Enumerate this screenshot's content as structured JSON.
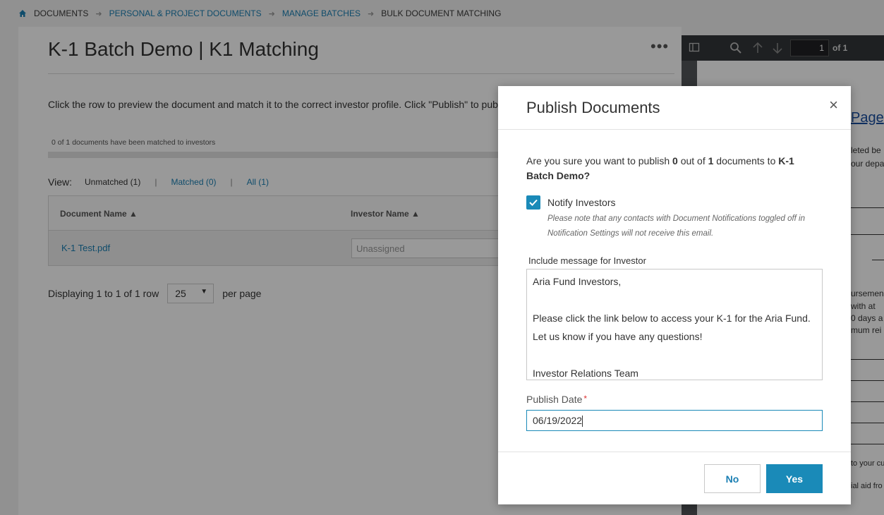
{
  "breadcrumb": {
    "items": [
      {
        "label": "DOCUMENTS"
      },
      {
        "label": "PERSONAL & PROJECT DOCUMENTS"
      },
      {
        "label": "MANAGE BATCHES"
      },
      {
        "label": "BULK DOCUMENT MATCHING"
      }
    ]
  },
  "page": {
    "title": "K-1 Batch Demo | K1 Matching",
    "more_label": "•••",
    "instructions": "Click the row to preview the document and match it to the correct investor profile. Click \"Publish\" to publish",
    "progress_text": "0 of 1 documents have been matched to investors",
    "view": {
      "label": "View:",
      "options": [
        {
          "label": "Unmatched (1)"
        },
        {
          "label": "Matched (0)"
        },
        {
          "label": "All (1)"
        }
      ]
    },
    "table": {
      "columns": [
        "Document Name ▲",
        "Investor Name ▲"
      ],
      "rows": [
        {
          "document": "K-1 Test.pdf",
          "investor_placeholder": "Unassigned"
        }
      ]
    },
    "paging": {
      "display_text": "Displaying 1 to 1 of 1 row",
      "page_size": "25",
      "per_page": "per page"
    }
  },
  "pdf": {
    "page_number": "1",
    "of_text": "of 1",
    "page_title_fragment": "Page",
    "snippets": [
      "leted be",
      "our depa",
      "ursemen",
      " with at",
      "0 days a",
      "mum rei",
      "to your cu",
      "ial aid fro"
    ]
  },
  "modal": {
    "title": "Publish Documents",
    "close_label": "×",
    "confirm": {
      "prefix": "Are you sure you want to publish ",
      "count": "0",
      "middle": " out of ",
      "total": "1",
      "suffix": " documents to ",
      "batch": "K-1 Batch Demo?"
    },
    "notify": {
      "label": "Notify Investors",
      "checked": true,
      "note": "Please note that any contacts with Document Notifications toggled off in Notification Settings will not receive this email."
    },
    "message": {
      "label": "Include message for Investor",
      "lines": [
        "Aria Fund Investors,",
        "",
        "Please click the link below to access your K-1 for the Aria Fund.",
        "Let us know if you have any questions!",
        "",
        "Investor Relations Team"
      ]
    },
    "publish_date": {
      "label": "Publish Date",
      "required_mark": "*",
      "value": "06/19/2022"
    },
    "buttons": {
      "no": "No",
      "yes": "Yes"
    }
  },
  "colors": {
    "accent": "#1a8ab8",
    "link": "#1a7fb3",
    "required": "#dd3333"
  }
}
